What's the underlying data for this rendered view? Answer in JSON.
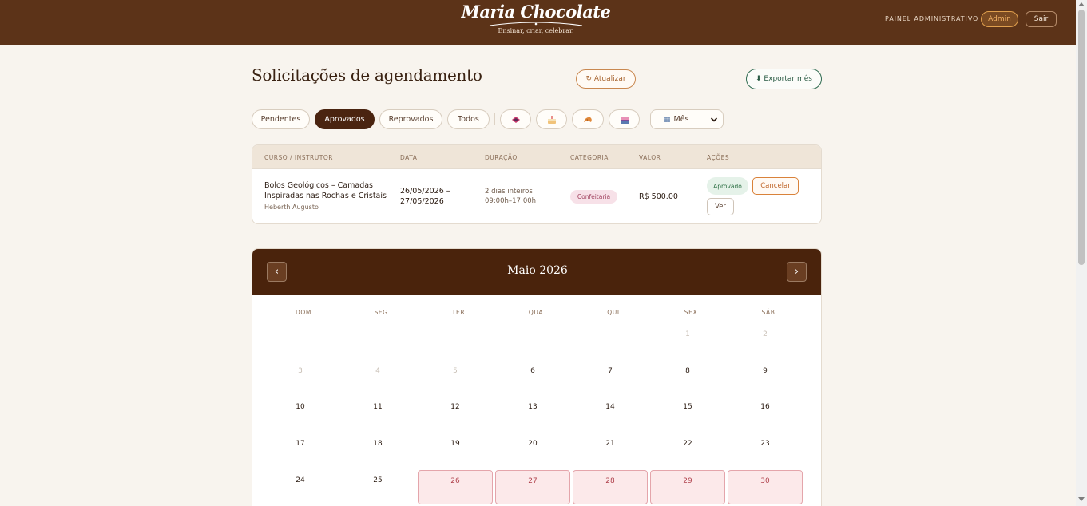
{
  "header": {
    "brand": "Maria Chocolate",
    "tagline": "Ensinar, criar, celebrar.",
    "panel_label": "PAINEL ADMINISTRATIVO",
    "admin_label": "Admin",
    "logout_label": "Sair"
  },
  "page": {
    "title": "Solicitações de agendamento",
    "refresh_label": "↻ Atualizar",
    "export_label": "⬇ Exportar mês"
  },
  "filters": {
    "status": [
      "Pendentes",
      "Aprovados",
      "Reprovados",
      "Todos"
    ],
    "active_status": "Aprovados",
    "category_icons": [
      "chocolate-icon",
      "cake-icon",
      "croissant-icon",
      "layer-cake-icon"
    ],
    "view_select": "Mês"
  },
  "table": {
    "headers": [
      "CURSO / INSTRUTOR",
      "DATA",
      "DURAÇÃO",
      "CATEGORIA",
      "VALOR",
      "AÇÕES"
    ],
    "rows": [
      {
        "course_line1": "Bolos Geológicos – Camadas",
        "course_line2": "Inspiradas nas Rochas e Cristais",
        "instructor": "Heberth Augusto",
        "date_line1": "26/05/2026 –",
        "date_line2": "27/05/2026",
        "duration_line1": "2 dias inteiros",
        "duration_line2": "09:00h–17:00h",
        "category": "Confeitaria",
        "value": "R$ 500.00",
        "status": "Aprovado",
        "cancel_label": "Cancelar",
        "view_label": "Ver"
      }
    ]
  },
  "calendar": {
    "title": "Maio 2026",
    "prev": "‹",
    "next": "›",
    "weekdays": [
      "DOM",
      "SEG",
      "TER",
      "QUA",
      "QUI",
      "SEX",
      "SÁB"
    ],
    "weeks": [
      [
        "",
        "",
        "",
        "",
        "",
        "1",
        "2"
      ],
      [
        "3",
        "4",
        "5",
        "6",
        "7",
        "8",
        "9"
      ],
      [
        "10",
        "11",
        "12",
        "13",
        "14",
        "15",
        "16"
      ],
      [
        "17",
        "18",
        "19",
        "20",
        "21",
        "22",
        "23"
      ],
      [
        "24",
        "25",
        "26",
        "27",
        "28",
        "29",
        "30"
      ]
    ],
    "muted_days": [
      "1",
      "2",
      "3",
      "4",
      "5"
    ],
    "booked_days": [
      "26",
      "27",
      "28",
      "29",
      "30"
    ],
    "colors": {
      "header": "#4a230c",
      "booked_bg": "#fce9ea",
      "booked_border": "#e4a5ab"
    }
  },
  "colors": {
    "topbar": "#5c3318",
    "page_bg": "#f8f4ee",
    "accent": "#c98850"
  }
}
